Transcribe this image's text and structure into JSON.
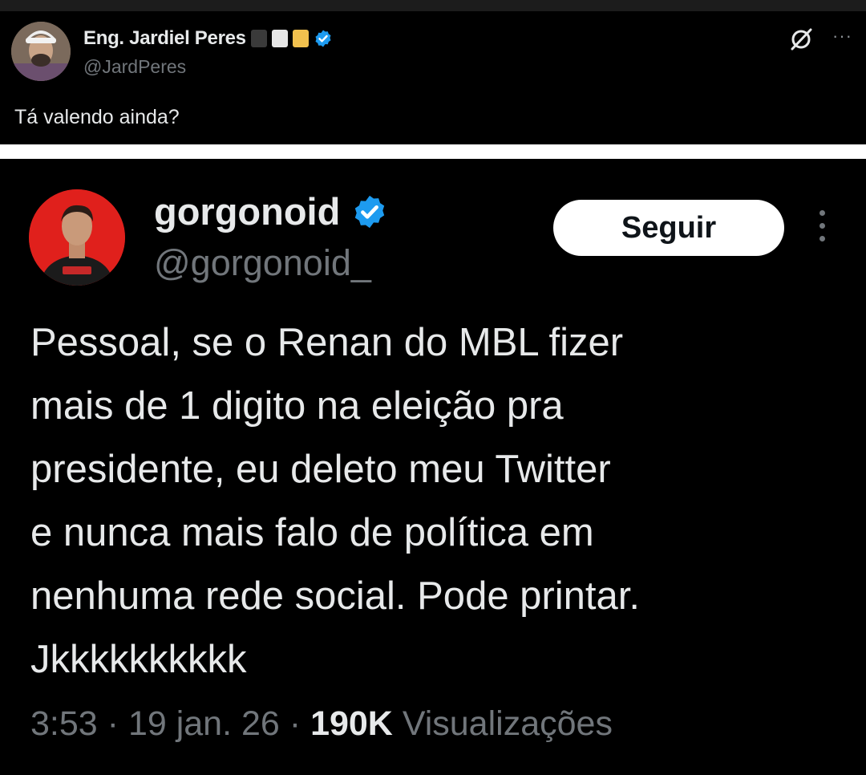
{
  "reply": {
    "display_name": "Eng. Jardiel Peres",
    "handle": "@JardPeres",
    "text": "Tá valendo ainda?",
    "flag_colors": [
      "#3a3a3a",
      "#e6e6e6",
      "#f2c14e"
    ],
    "icons": [
      "avatar",
      "verified-badge-icon",
      "grok-icon",
      "more-icon"
    ]
  },
  "quoted": {
    "display_name": "gorgonoid",
    "handle": "@gorgonoid_",
    "follow_label": "Seguir",
    "text_lines": [
      "Pessoal, se o Renan do MBL fizer",
      "mais de 1 digito na eleição pra",
      "presidente, eu deleto meu Twitter",
      "e nunca mais falo de política em",
      "nenhuma rede social. Pode printar.",
      "Jkkkkkkkkkk"
    ],
    "time": "3:53",
    "date": "19 jan. 26",
    "views_count": "190K",
    "views_label": "Visualizações",
    "icons": [
      "avatar",
      "verified-badge-icon",
      "more-vertical-icon"
    ]
  },
  "colors": {
    "background": "#000000",
    "text": "#e7e9ea",
    "secondary_text": "#71767b",
    "verified_blue": "#1d9bf0",
    "avatar_red": "#e0201c"
  }
}
